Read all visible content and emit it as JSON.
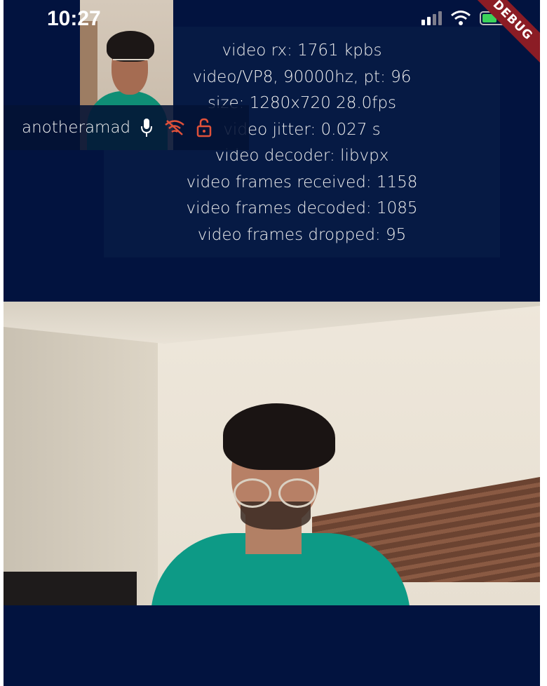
{
  "status_bar": {
    "time": "10:27",
    "icons": [
      "cellular-signal-icon",
      "wifi-icon",
      "battery-charging-icon"
    ]
  },
  "debug_banner": {
    "label": "DEBUG",
    "color": "#8b1c25"
  },
  "stats": {
    "lines": [
      "video rx: 1761 kpbs",
      "video/VP8, 90000hz, pt: 96",
      "size: 1280x720 28.0fps",
      "video jitter: 0.027 s",
      "video decoder: libvpx",
      "video frames received: 1158",
      "video frames decoded: 1085",
      "video frames dropped: 95"
    ]
  },
  "participant": {
    "name": "anotheramad",
    "icons": [
      "microphone-icon",
      "wifi-off-icon",
      "unlocked-icon"
    ],
    "warning_color": "#e0513a"
  },
  "colors": {
    "background": "#02133f",
    "overlay": "#061a44",
    "battery": "#3bd35a"
  }
}
